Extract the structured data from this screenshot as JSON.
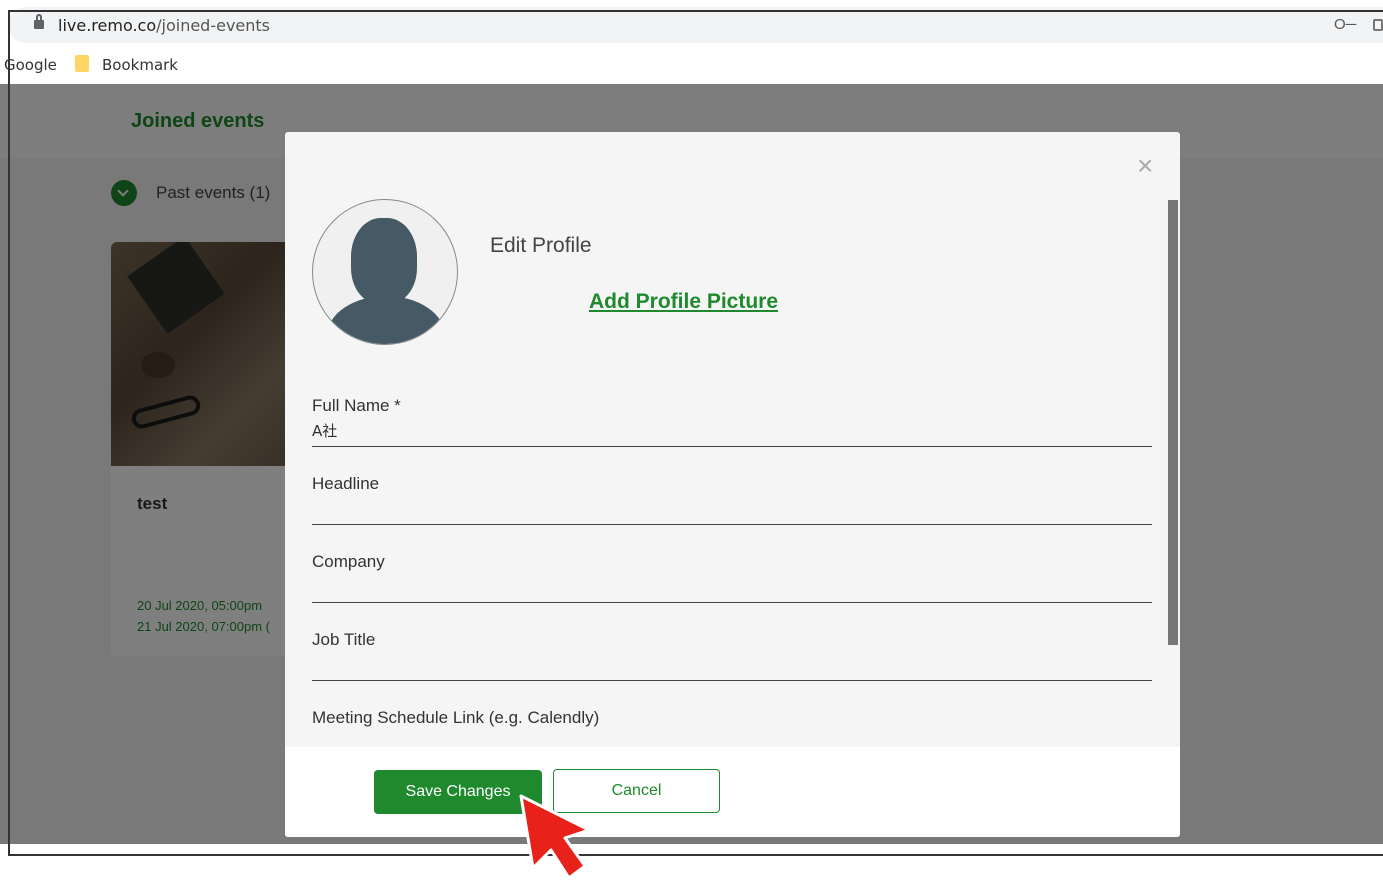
{
  "browser": {
    "url_host": "live.remo.co",
    "url_path": "/joined-events",
    "bookmarks": [
      "Google",
      "Bookmark"
    ]
  },
  "page": {
    "title": "Joined events",
    "past_events_label": "Past events (1)",
    "card": {
      "title": "test",
      "date_start": "20 Jul 2020, 05:00pm",
      "date_end": "21 Jul 2020, 07:00pm ("
    }
  },
  "modal": {
    "title": "Edit Profile",
    "add_picture": "Add Profile Picture",
    "fields": [
      {
        "label": "Full Name *",
        "value": "A社"
      },
      {
        "label": "Headline",
        "value": ""
      },
      {
        "label": "Company",
        "value": ""
      },
      {
        "label": "Job Title",
        "value": ""
      },
      {
        "label": "Meeting Schedule Link (e.g. Calendly)",
        "value": ""
      }
    ],
    "save_label": "Save Changes",
    "cancel_label": "Cancel",
    "close_symbol": "×"
  },
  "colors": {
    "accent": "#1e8a2d",
    "annotation_arrow": "#e8211b"
  },
  "icons": [
    "lock-icon",
    "key-icon",
    "folder-icon",
    "chevron-down-icon",
    "close-icon",
    "avatar-placeholder-icon",
    "pointer-arrow-icon"
  ]
}
